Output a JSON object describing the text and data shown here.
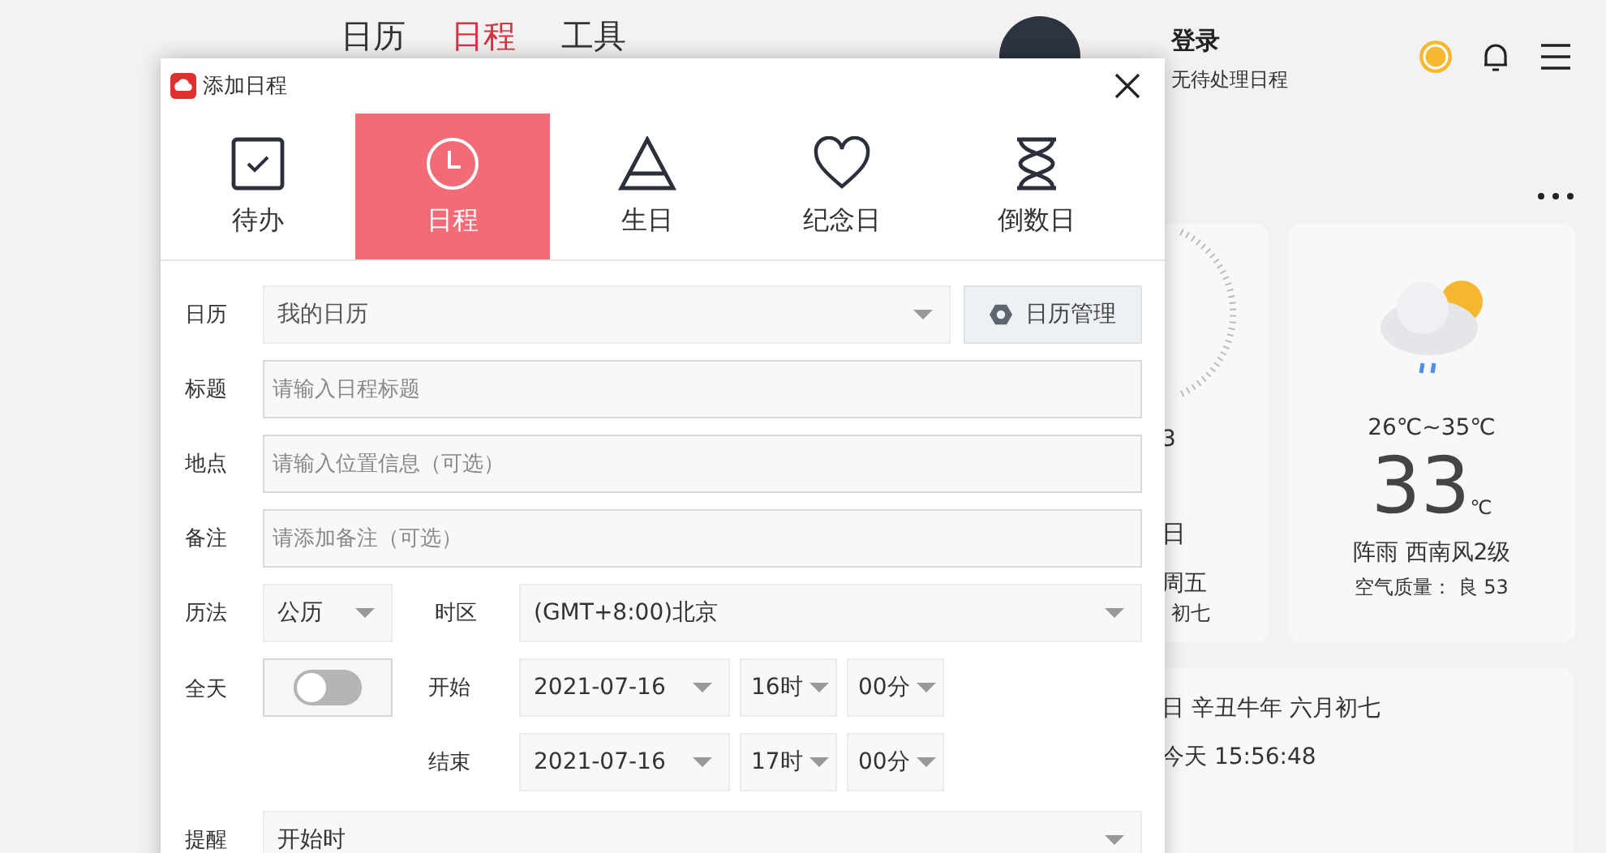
{
  "nav": [
    {
      "label": "日历",
      "selected": false
    },
    {
      "label": "日程",
      "selected": true
    },
    {
      "label": "工具",
      "selected": false
    }
  ],
  "account": {
    "login": "登录",
    "status": "无待处理日程"
  },
  "clock_card": {
    "fragments": [
      "3",
      "日",
      "周五",
      "初七"
    ]
  },
  "weather": {
    "range": "26℃~35℃",
    "temperature": "33",
    "unit": "℃",
    "description": "阵雨 西南风2级",
    "air_quality": "空气质量： 良 53"
  },
  "lunar_card": {
    "date": "日 辛丑牛年 六月初七",
    "time": "今天 15:56:48"
  },
  "dialog": {
    "title": "添加日程",
    "types": [
      {
        "label": "待办",
        "kind": "todo",
        "selected": false
      },
      {
        "label": "日程",
        "kind": "schedule",
        "selected": true
      },
      {
        "label": "生日",
        "kind": "birthday",
        "selected": false
      },
      {
        "label": "纪念日",
        "kind": "anniversary",
        "selected": false
      },
      {
        "label": "倒数日",
        "kind": "countdown",
        "selected": false
      }
    ],
    "calendar": {
      "label": "日历",
      "value": "我的日历",
      "button": "日历管理"
    },
    "text_fields": [
      {
        "label": "标题",
        "placeholder": "请输入日程标题"
      },
      {
        "label": "地点",
        "placeholder": "请输入位置信息（可选）"
      },
      {
        "label": "备注",
        "placeholder": "请添加备注（可选）"
      }
    ],
    "calendar_type": {
      "label": "历法",
      "value": "公历"
    },
    "timezone": {
      "label": "时区",
      "value": "(GMT+8:00)北京"
    },
    "all_day": {
      "label": "全天",
      "on": false
    },
    "times": [
      {
        "label": "开始",
        "date": "2021-07-16",
        "hour": "16时",
        "minute": "00分"
      },
      {
        "label": "结束",
        "date": "2021-07-16",
        "hour": "17时",
        "minute": "00分"
      }
    ],
    "reminder": {
      "label": "提醒",
      "value": "开始时"
    }
  }
}
